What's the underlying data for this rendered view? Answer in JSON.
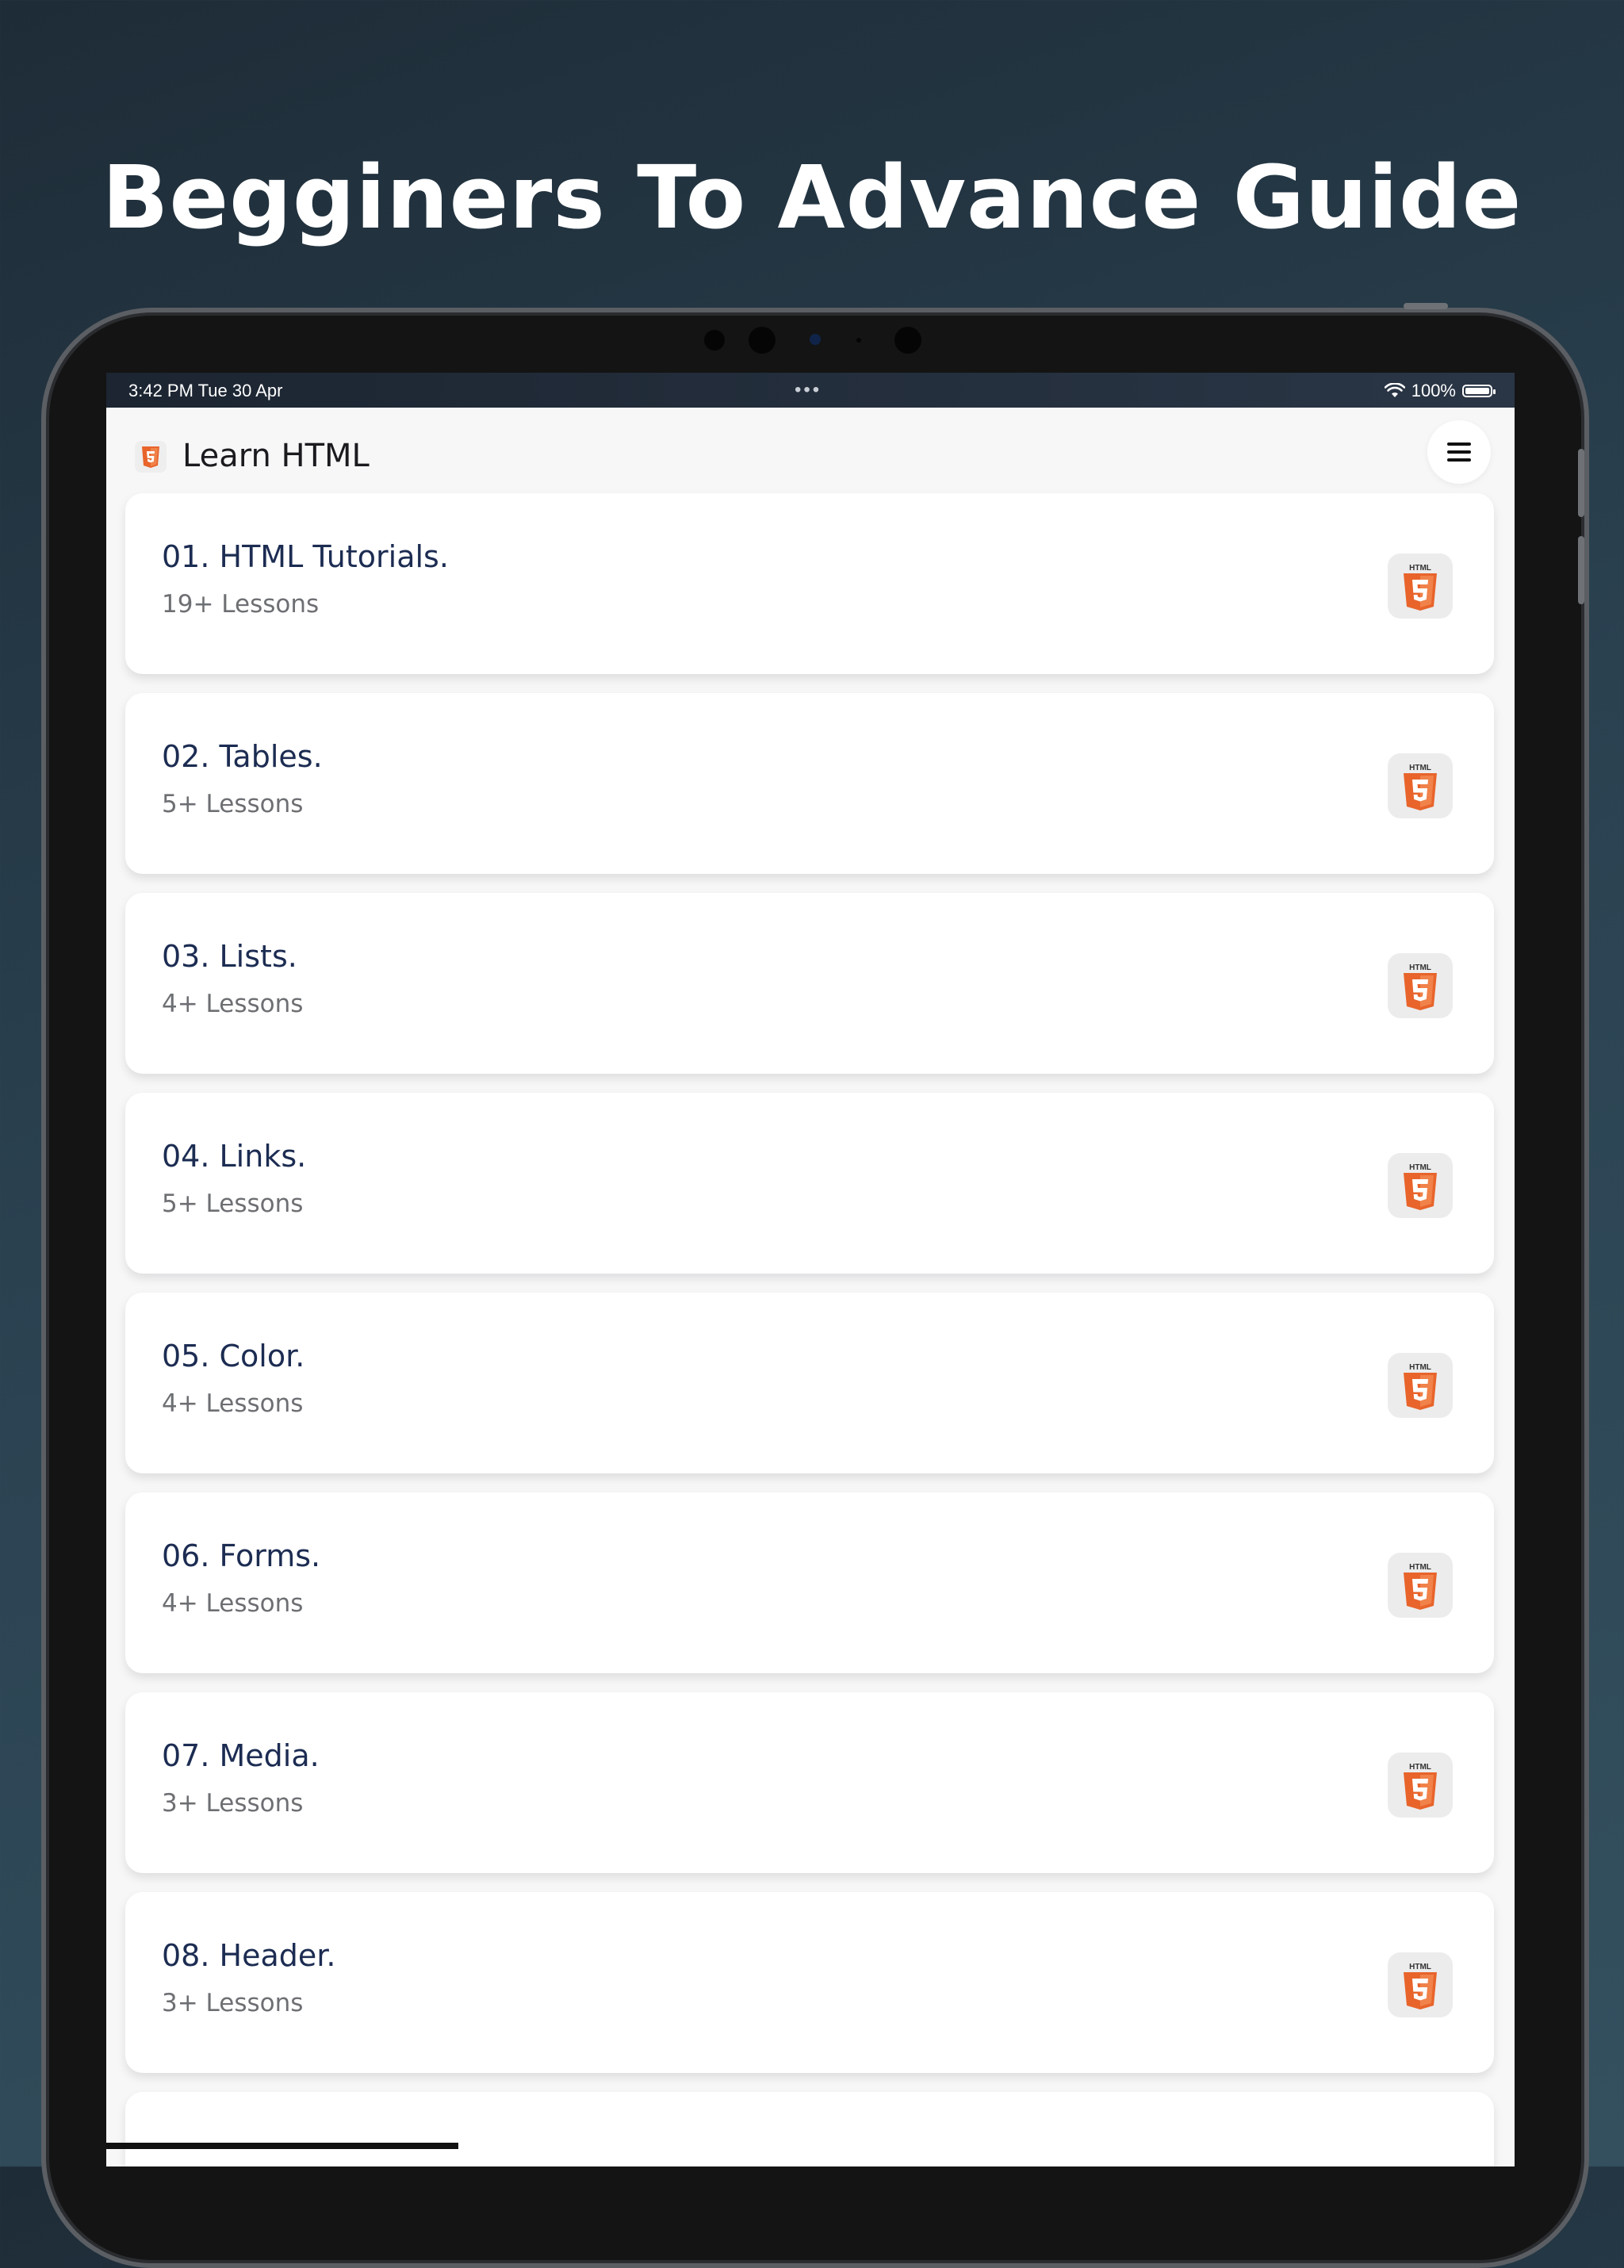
{
  "headline": "Begginers To Advance Guide",
  "status_bar": {
    "time": "3:42 PM   Tue 30 Apr",
    "dots": "•••",
    "battery": "100%"
  },
  "app_bar": {
    "title": "Learn HTML",
    "logo_icon": "html5-logo-icon",
    "menu_icon": "hamburger-menu-icon"
  },
  "lessons": [
    {
      "title": "01. HTML Tutorials.",
      "subtitle": "19+ Lessons"
    },
    {
      "title": "02. Tables.",
      "subtitle": "5+ Lessons"
    },
    {
      "title": "03. Lists.",
      "subtitle": "4+ Lessons"
    },
    {
      "title": "04. Links.",
      "subtitle": "5+ Lessons"
    },
    {
      "title": "05. Color.",
      "subtitle": "4+ Lessons"
    },
    {
      "title": "06. Forms.",
      "subtitle": "4+ Lessons"
    },
    {
      "title": "07. Media.",
      "subtitle": "3+ Lessons"
    },
    {
      "title": "08. Header.",
      "subtitle": "3+ Lessons"
    }
  ],
  "html5_badge_text": "HTML",
  "colors": {
    "background_top": "#1e2c37",
    "background_bottom": "#34505f",
    "title_text": "#1c2c52",
    "subtitle_text": "#6d6f73",
    "html5_orange": "#e8642b"
  }
}
